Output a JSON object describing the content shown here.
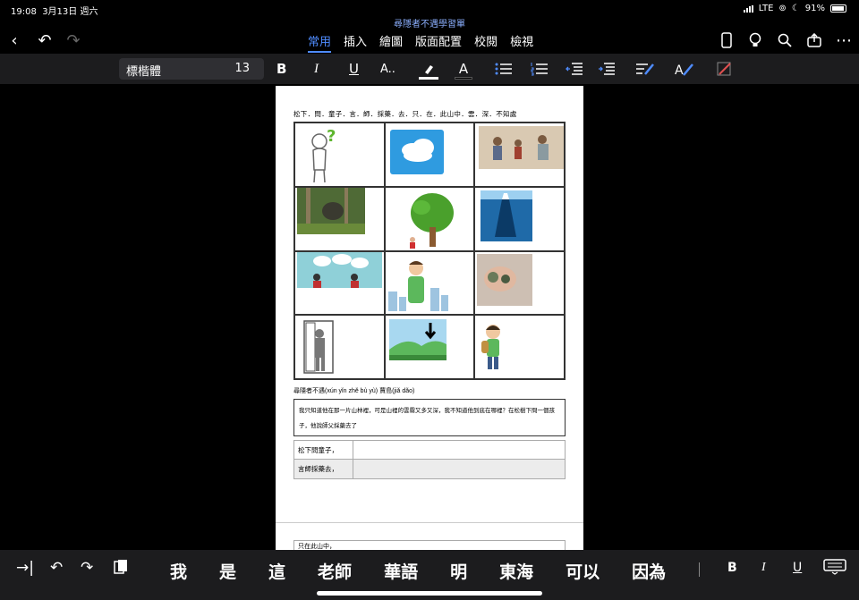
{
  "status_bar": {
    "time": "19:08",
    "date": "3月13日 週六",
    "network": "LTE",
    "battery": "91%"
  },
  "document": {
    "title": "尋隱者不遇學習單"
  },
  "menu": {
    "tabs": [
      {
        "label": "常用",
        "active": true
      },
      {
        "label": "插入",
        "active": false
      },
      {
        "label": "繪圖",
        "active": false
      },
      {
        "label": "版面配置",
        "active": false
      },
      {
        "label": "校閱",
        "active": false
      },
      {
        "label": "檢視",
        "active": false
      }
    ]
  },
  "format_bar": {
    "font_name": "標楷體",
    "font_size": "13",
    "bold": "B",
    "italic": "I",
    "underline": "U",
    "font_effects": "A..",
    "font_color": "A"
  },
  "page": {
    "verse": "松下．問．童子．言．師．採藥．去．只．在．此山中．雲．深．不知處",
    "pinyin": "尋隱者不遇(xún yǐn zhě  bù  yù)      賈島(jiǎ  dǎo)",
    "description": "我只知道他在那一片山林裡，可是山裡的雲霧又多又深，我不知道他到底在哪裡？在松樹下問一個孩子，他說師父採藥去了",
    "rows": [
      {
        "label": "松下問童子，"
      },
      {
        "label": "言師採藥去，"
      }
    ],
    "next_row_label": "只在此山中，"
  },
  "keyboard": {
    "candidates": [
      "我",
      "是",
      "這",
      "老師",
      "華語",
      "明",
      "東海",
      "可以",
      "因為"
    ],
    "bold": "B",
    "italic": "I",
    "underline": "U"
  },
  "colors": {
    "accent": "#4f8cff",
    "background": "#000000",
    "toolbar": "#1c1c1e"
  }
}
